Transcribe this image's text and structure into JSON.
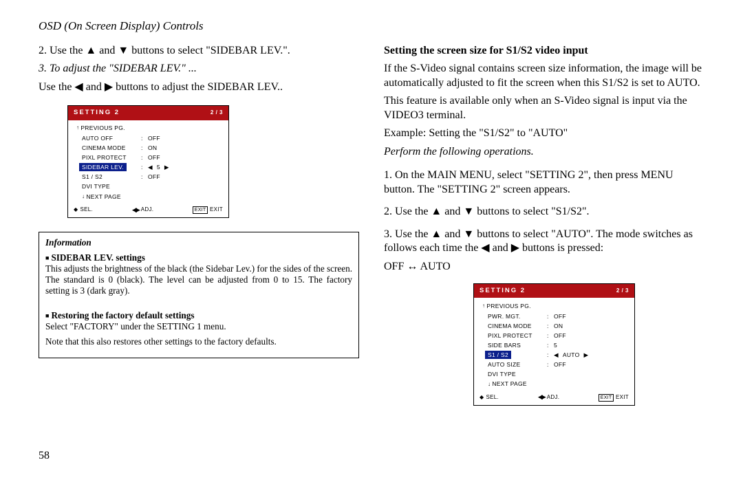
{
  "page": {
    "title": "OSD (On Screen Display) Controls",
    "number": "58"
  },
  "left": {
    "step2": "2. Use the ▲ and ▼ buttons to select \"SIDEBAR LEV.\".",
    "step3_title": "3. To adjust the \"SIDEBAR LEV.\" ...",
    "step3_body": "Use the ◀ and ▶ buttons to adjust the SIDEBAR LEV..",
    "info_label": "Information",
    "bullet1_head": "SIDEBAR LEV. settings",
    "bullet1_body": "This adjusts the brightness of the black (the Sidebar Lev.) for the sides of the screen. The standard is 0 (black). The level can be adjusted from 0 to 15. The factory setting is 3 (dark gray).",
    "bullet2_head": "Restoring the factory default settings",
    "bullet2_body1": "Select \"FACTORY\" under the SETTING 1 menu.",
    "bullet2_body2": "Note that this also restores other settings to the factory defaults."
  },
  "right": {
    "heading": "Setting the screen size for S1/S2 video input",
    "p1": "If the S-Video signal contains screen size information, the image will be automatically adjusted to fit the screen when this S1/S2 is set to AUTO.",
    "p2": "This feature is available only when an S-Video signal is input via the VIDEO3 terminal.",
    "p3": "Example:  Setting the \"S1/S2\" to \"AUTO\"",
    "perform": "Perform the following operations.",
    "s1": "1. On the MAIN MENU, select \"SETTING 2\", then press MENU button.  The \"SETTING 2\" screen appears.",
    "s2": "2. Use the ▲ and ▼ buttons to select \"S1/S2\".",
    "s3a": "3. Use the ▲ and ▼ buttons to select \"AUTO\".  The mode switches as follows each time the ◀ and ▶ buttons is pressed:",
    "s3b": "OFF ↔ AUTO"
  },
  "osd1": {
    "title": "SETTING 2",
    "page": "2 / 3",
    "prev": "PREVIOUS PG.",
    "rows": [
      {
        "label": "AUTO OFF",
        "val": "OFF"
      },
      {
        "label": "CINEMA MODE",
        "val": "ON"
      },
      {
        "label": "PIXL PROTECT",
        "val": "OFF"
      }
    ],
    "hl_label": "SIDEBAR LEV.",
    "hl_val": "5",
    "rows2": [
      {
        "label": "S1 / S2",
        "val": "OFF"
      },
      {
        "label": "DVI TYPE",
        "val": ""
      }
    ],
    "next": "NEXT PAGE",
    "sel": "SEL.",
    "adj": "ADJ.",
    "exit_icon": "EXIT",
    "exit": "EXIT"
  },
  "osd2": {
    "title": "SETTING 2",
    "page": "2 / 3",
    "prev": "PREVIOUS PG.",
    "rows": [
      {
        "label": "PWR. MGT.",
        "val": "OFF"
      },
      {
        "label": "CINEMA MODE",
        "val": "ON"
      },
      {
        "label": "PIXL PROTECT",
        "val": "OFF"
      },
      {
        "label": "SIDE BARS",
        "val": "5"
      }
    ],
    "hl_label": "S1 / S2",
    "hl_val": "AUTO",
    "rows2": [
      {
        "label": "AUTO SIZE",
        "val": "OFF"
      },
      {
        "label": "DVI TYPE",
        "val": ""
      }
    ],
    "next": "NEXT PAGE",
    "sel": "SEL.",
    "adj": "ADJ.",
    "exit_icon": "EXIT",
    "exit": "EXIT"
  }
}
